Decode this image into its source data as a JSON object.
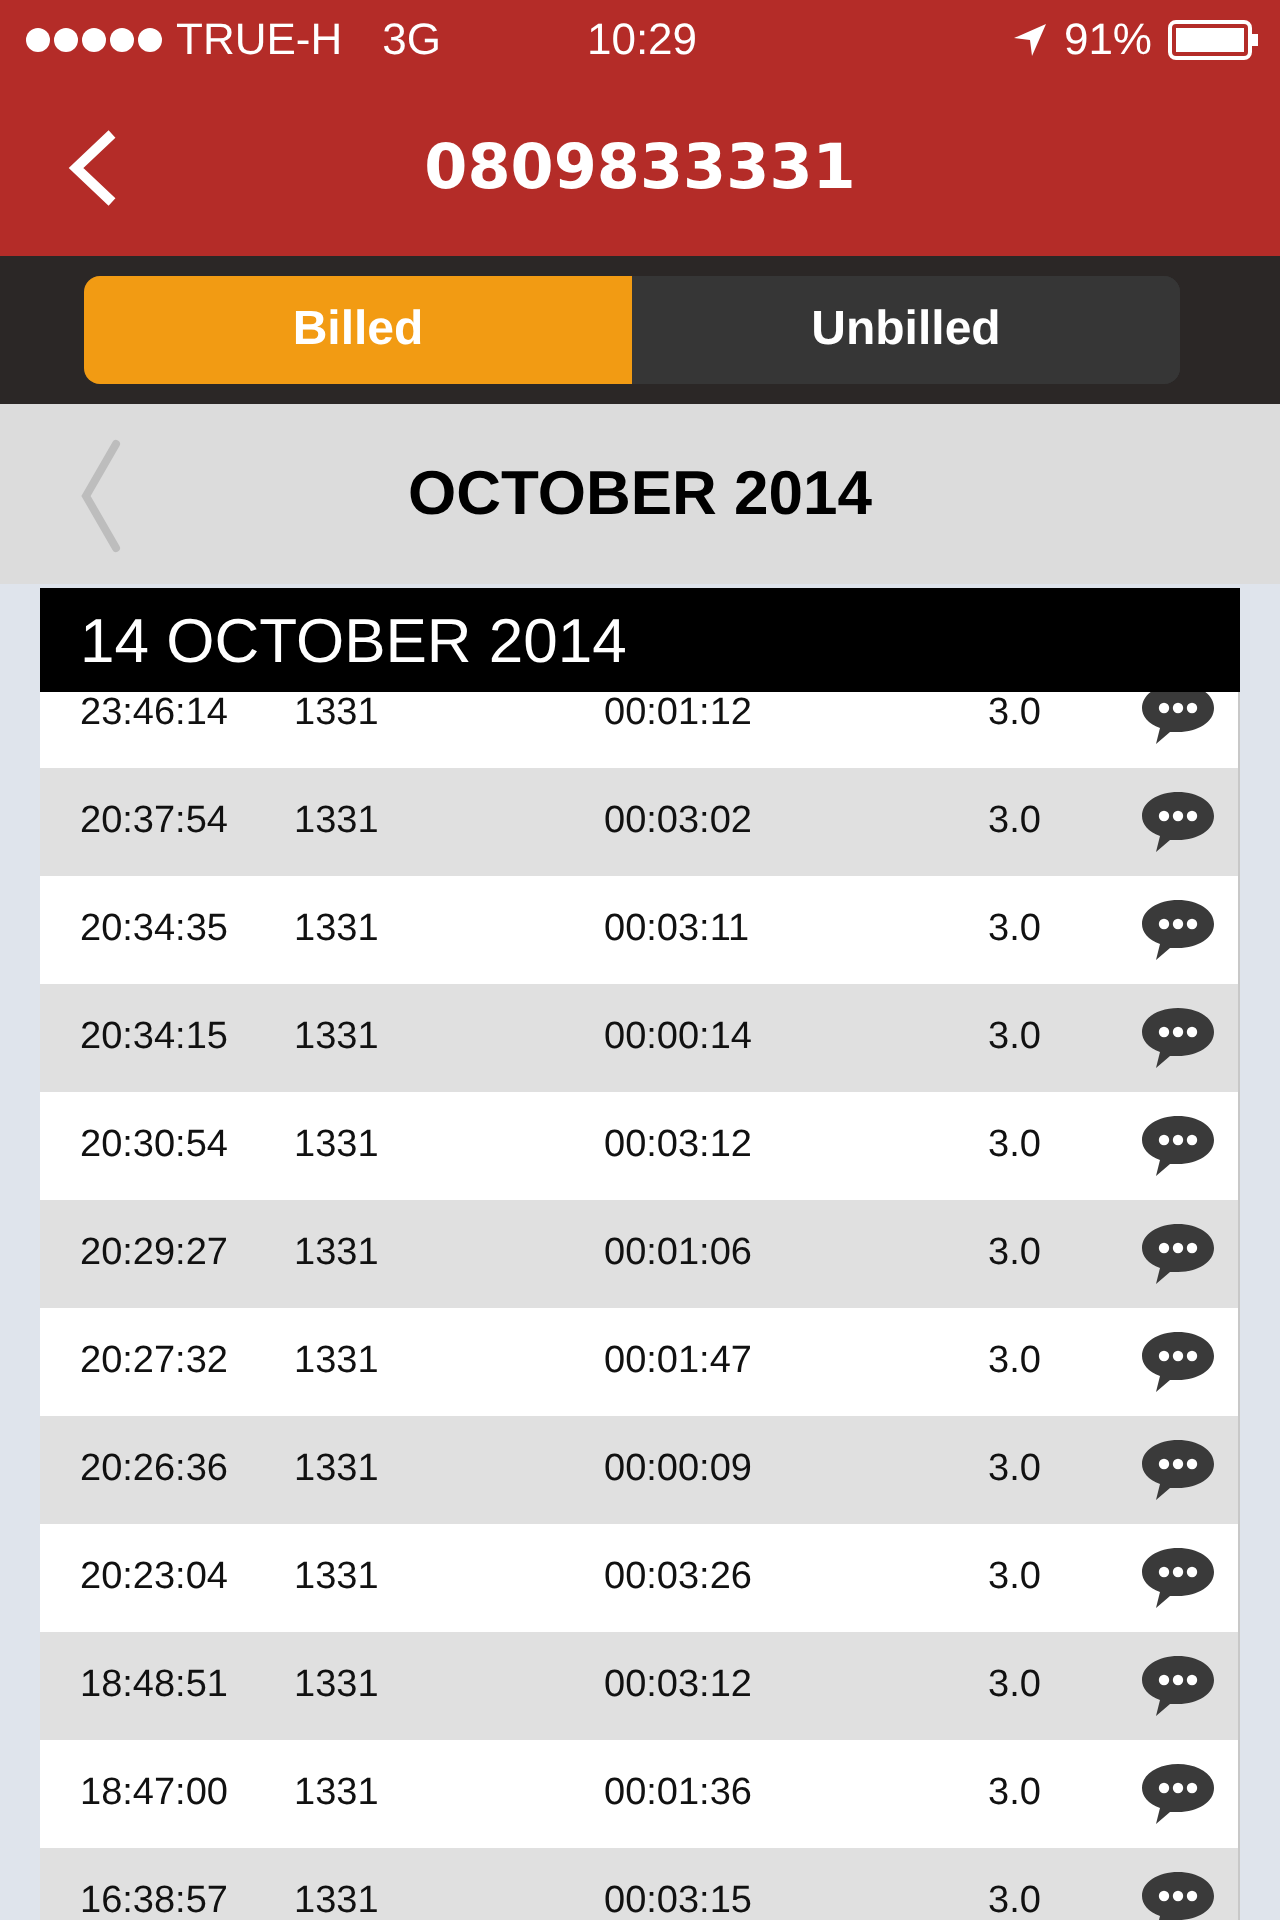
{
  "status_bar": {
    "carrier": "TRUE-H",
    "network": "3G",
    "time": "10:29",
    "battery": "91%"
  },
  "header": {
    "title": "0809833331"
  },
  "tabs": [
    {
      "label": "Billed",
      "selected": true
    },
    {
      "label": "Unbilled",
      "selected": false
    }
  ],
  "month": {
    "title": "OCTOBER 2014"
  },
  "day": {
    "title": "14 OCTOBER 2014"
  },
  "calls": [
    {
      "time": "23:46:14",
      "number": "1331",
      "duration": "00:01:12",
      "amount": "3.0"
    },
    {
      "time": "20:37:54",
      "number": "1331",
      "duration": "00:03:02",
      "amount": "3.0"
    },
    {
      "time": "20:34:35",
      "number": "1331",
      "duration": "00:03:11",
      "amount": "3.0"
    },
    {
      "time": "20:34:15",
      "number": "1331",
      "duration": "00:00:14",
      "amount": "3.0"
    },
    {
      "time": "20:30:54",
      "number": "1331",
      "duration": "00:03:12",
      "amount": "3.0"
    },
    {
      "time": "20:29:27",
      "number": "1331",
      "duration": "00:01:06",
      "amount": "3.0"
    },
    {
      "time": "20:27:32",
      "number": "1331",
      "duration": "00:01:47",
      "amount": "3.0"
    },
    {
      "time": "20:26:36",
      "number": "1331",
      "duration": "00:00:09",
      "amount": "3.0"
    },
    {
      "time": "20:23:04",
      "number": "1331",
      "duration": "00:03:26",
      "amount": "3.0"
    },
    {
      "time": "18:48:51",
      "number": "1331",
      "duration": "00:03:12",
      "amount": "3.0"
    },
    {
      "time": "18:47:00",
      "number": "1331",
      "duration": "00:01:36",
      "amount": "3.0"
    },
    {
      "time": "16:38:57",
      "number": "1331",
      "duration": "00:03:15",
      "amount": "3.0"
    }
  ]
}
